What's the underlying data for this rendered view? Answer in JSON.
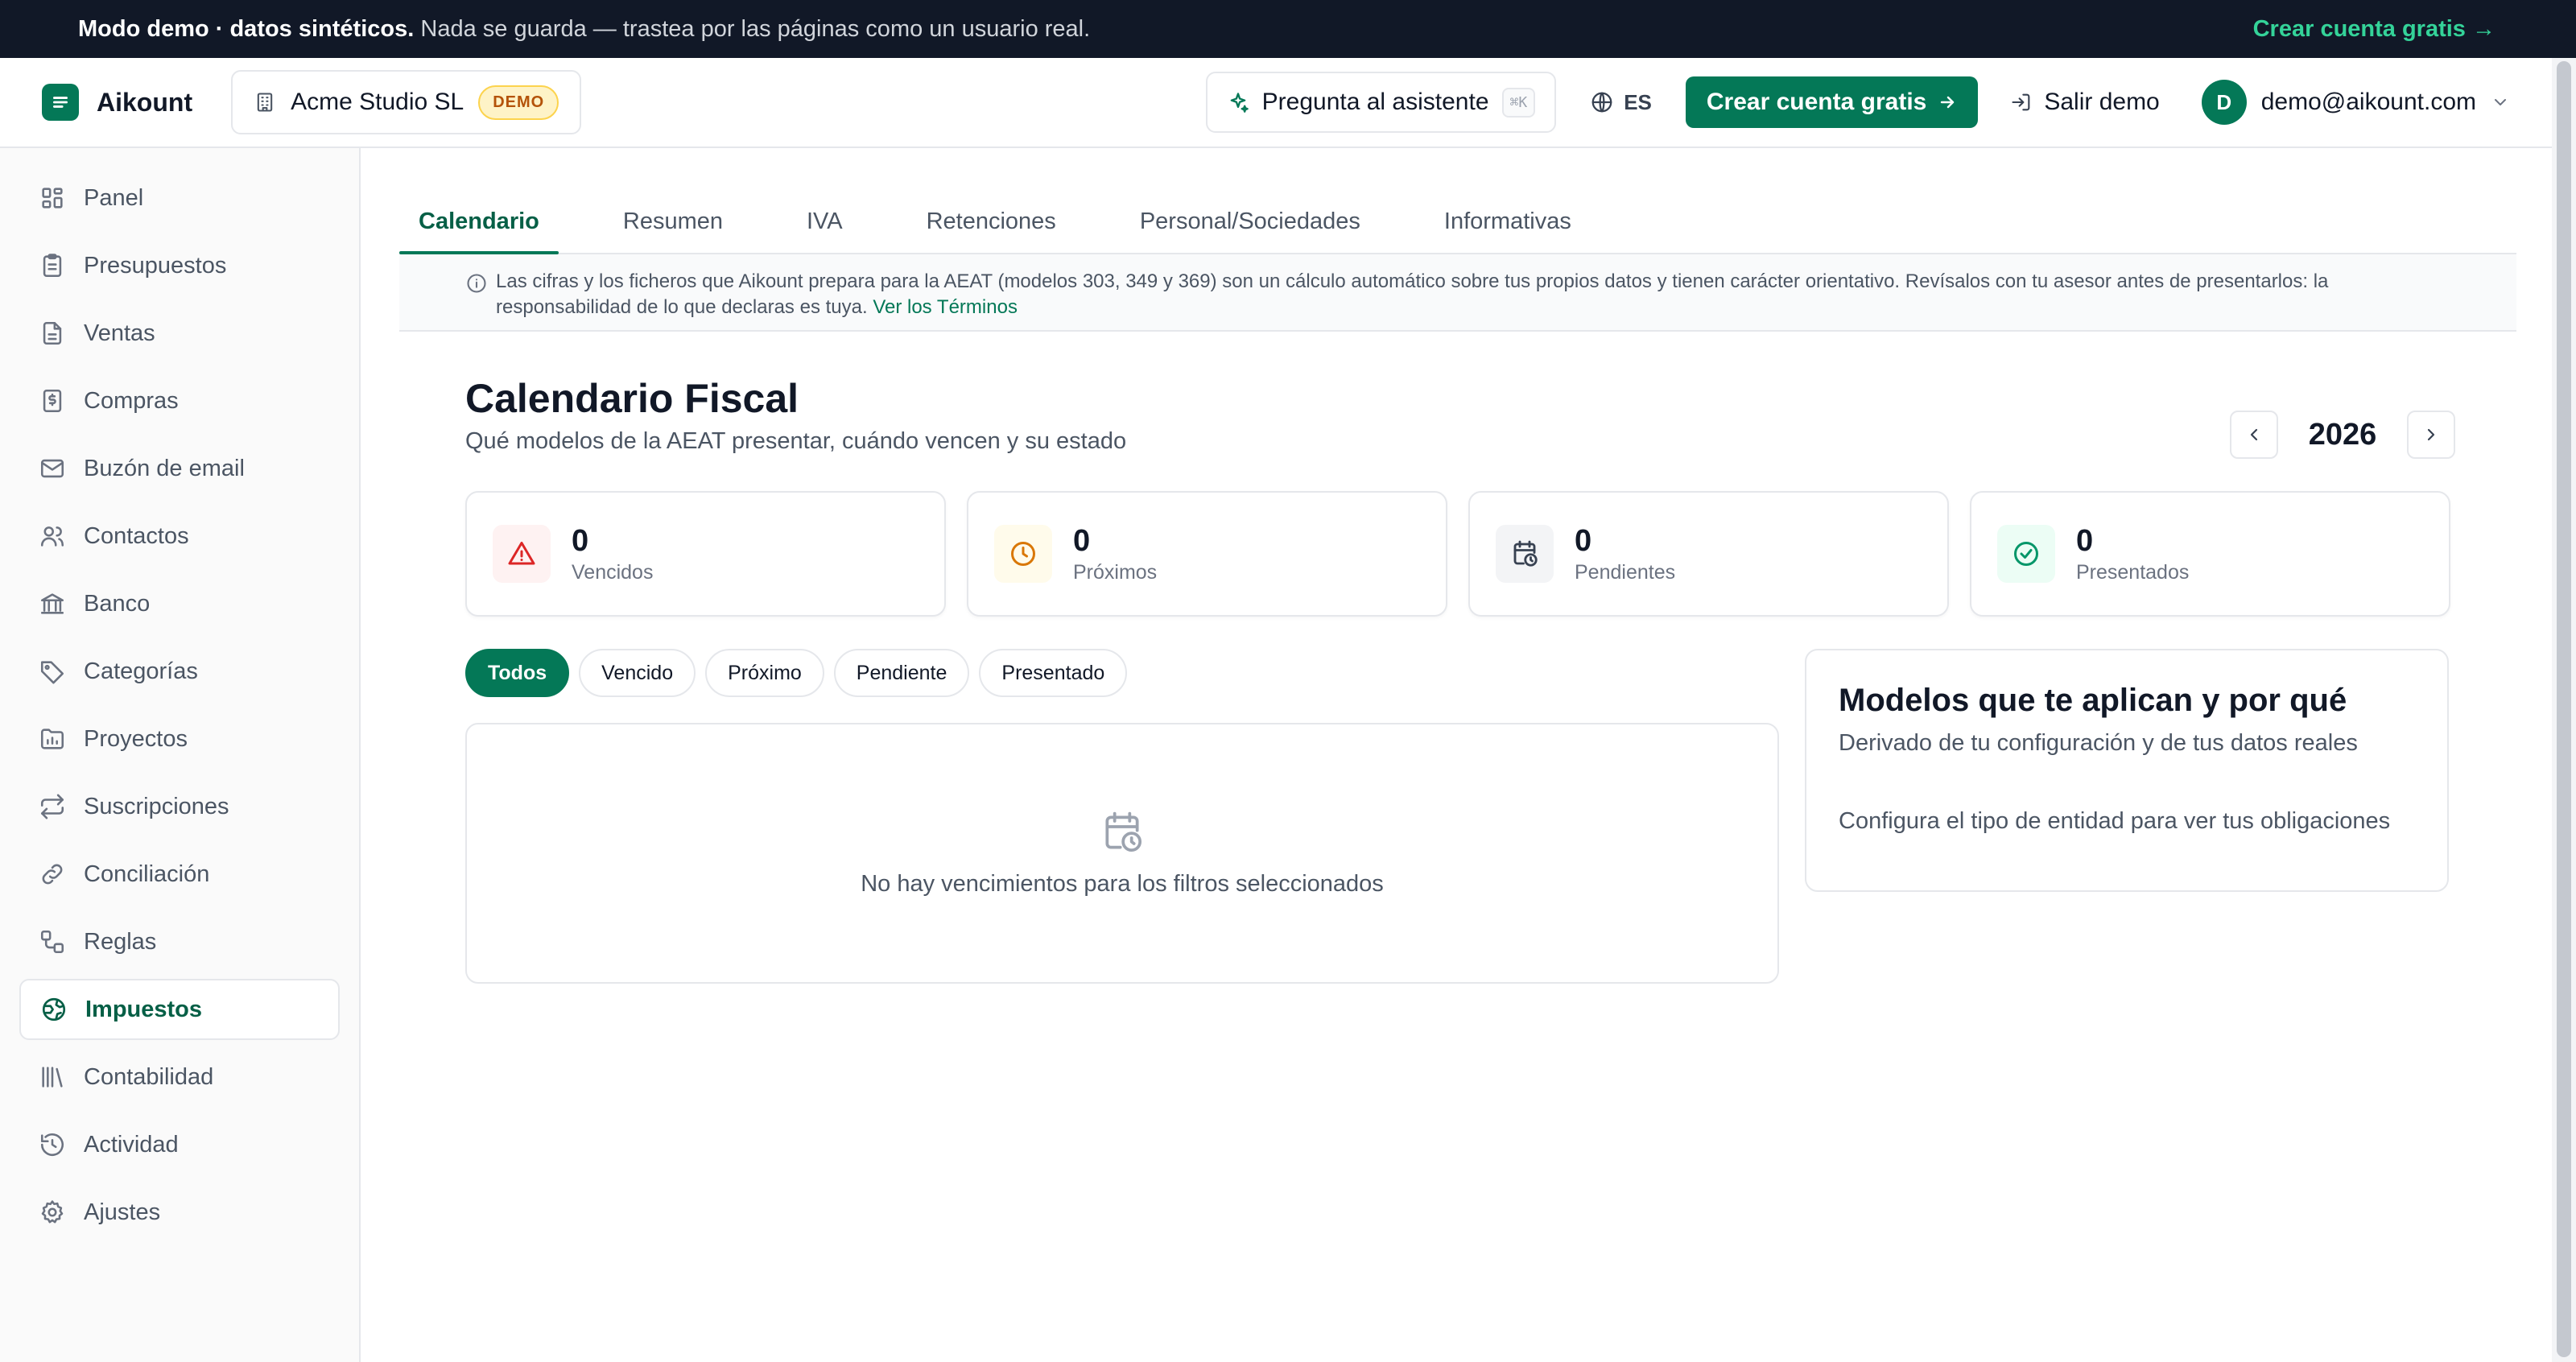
{
  "banner": {
    "bold_text": "Modo demo · datos sintéticos.",
    "text": " Nada se guarda — trastea por las páginas como un usuario real.",
    "link_label": "Crear cuenta gratis →"
  },
  "header": {
    "app_name": "Aikount",
    "company": "Acme Studio SL",
    "company_badge": "DEMO",
    "assistant_label": "Pregunta al asistente",
    "assistant_shortcut": "⌘K",
    "language": "ES",
    "cta_label": "Crear cuenta gratis",
    "exit_label": "Salir demo",
    "user_initial": "D",
    "user_email": "demo@aikount.com"
  },
  "sidebar": {
    "items": [
      {
        "label": "Panel",
        "icon": "grid-icon"
      },
      {
        "label": "Presupuestos",
        "icon": "clipboard-icon"
      },
      {
        "label": "Ventas",
        "icon": "document-icon"
      },
      {
        "label": "Compras",
        "icon": "receipt-icon"
      },
      {
        "label": "Buzón de email",
        "icon": "mail-icon"
      },
      {
        "label": "Contactos",
        "icon": "users-icon"
      },
      {
        "label": "Banco",
        "icon": "bank-icon"
      },
      {
        "label": "Categorías",
        "icon": "tag-icon"
      },
      {
        "label": "Proyectos",
        "icon": "folder-chart-icon"
      },
      {
        "label": "Suscripciones",
        "icon": "repeat-icon"
      },
      {
        "label": "Conciliación",
        "icon": "link-icon"
      },
      {
        "label": "Reglas",
        "icon": "workflow-icon"
      },
      {
        "label": "Impuestos",
        "icon": "globe-icon"
      },
      {
        "label": "Contabilidad",
        "icon": "library-icon"
      },
      {
        "label": "Actividad",
        "icon": "history-icon"
      },
      {
        "label": "Ajustes",
        "icon": "gear-icon"
      }
    ],
    "active_index": 12
  },
  "tabs": [
    {
      "label": "Calendario"
    },
    {
      "label": "Resumen"
    },
    {
      "label": "IVA"
    },
    {
      "label": "Retenciones"
    },
    {
      "label": "Personal/Sociedades"
    },
    {
      "label": "Informativas"
    }
  ],
  "notice": {
    "text": "Las cifras y los ficheros que Aikount prepara para la AEAT (modelos 303, 349 y 369) son un cálculo automático sobre tus propios datos y tienen carácter orientativo. Revísalos con tu asesor antes de presentarlos: la responsabilidad de lo que declaras es tuya.",
    "link": "Ver los Términos"
  },
  "page": {
    "title": "Calendario Fiscal",
    "subtitle": "Qué modelos de la AEAT presentar, cuándo vencen y su estado",
    "year": "2026"
  },
  "stats": [
    {
      "value": "0",
      "label": "Vencidos",
      "icon": "alert-triangle-icon",
      "color": "#dc2626",
      "bg": "#fef2f2"
    },
    {
      "value": "0",
      "label": "Próximos",
      "icon": "clock-icon",
      "color": "#d97706",
      "bg": "#fffbeb"
    },
    {
      "value": "0",
      "label": "Pendientes",
      "icon": "calendar-clock-icon",
      "color": "#374151",
      "bg": "#f3f4f6"
    },
    {
      "value": "0",
      "label": "Presentados",
      "icon": "check-circle-icon",
      "color": "#059669",
      "bg": "#ecfdf5"
    }
  ],
  "filters": [
    {
      "label": "Todos"
    },
    {
      "label": "Vencido"
    },
    {
      "label": "Próximo"
    },
    {
      "label": "Pendiente"
    },
    {
      "label": "Presentado"
    }
  ],
  "empty": {
    "text": "No hay vencimientos para los filtros seleccionados"
  },
  "models": {
    "title": "Modelos que te aplican y por qué",
    "subtitle": "Derivado de tu configuración y de tus datos reales",
    "hint": "Configura el tipo de entidad para ver tus obligaciones"
  },
  "colors": {
    "accent": "#047857",
    "banner_bg": "#111827",
    "banner_link": "#34d399"
  }
}
